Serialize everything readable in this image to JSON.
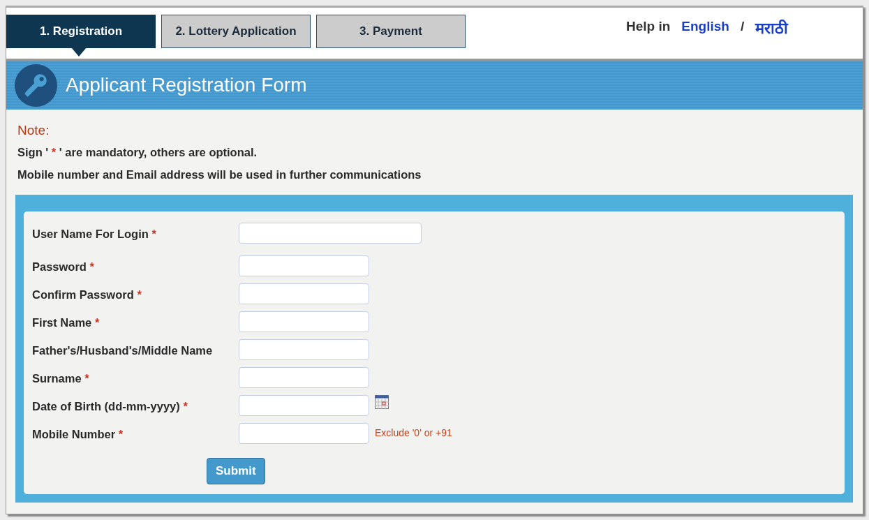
{
  "steps": [
    {
      "label": "1. Registration",
      "selected": true
    },
    {
      "label": "2. Lottery Application",
      "selected": false
    },
    {
      "label": "3. Payment",
      "selected": false
    }
  ],
  "help": {
    "label": "Help in",
    "links": [
      "English",
      "मराठी"
    ],
    "separator": "/"
  },
  "form_title": "Applicant Registration Form",
  "note": {
    "heading": "Note:",
    "line_1": {
      "before": "Sign '",
      "mark": "*",
      "after": "' are mandatory, others are optional."
    },
    "line_2": "Mobile number and Email address will be used in further communications"
  },
  "fields": [
    {
      "label": "User Name For Login",
      "required": true,
      "kind": "wide"
    },
    {
      "label": "Password",
      "required": true,
      "kind": "normal"
    },
    {
      "label": "Confirm Password",
      "required": true,
      "kind": "normal"
    },
    {
      "label": "First Name",
      "required": true,
      "kind": "normal"
    },
    {
      "label": "Father's/Husband's/Middle Name",
      "required": false,
      "kind": "normal"
    },
    {
      "label": "Surname",
      "required": true,
      "kind": "normal"
    },
    {
      "label": "Date of Birth (dd-mm-yyyy)",
      "required": true,
      "kind": "date"
    },
    {
      "label": "Mobile Number",
      "required": true,
      "kind": "normal",
      "hint": "Exclude '0' or +91"
    }
  ],
  "required_mark": "*",
  "submit": "Submit"
}
